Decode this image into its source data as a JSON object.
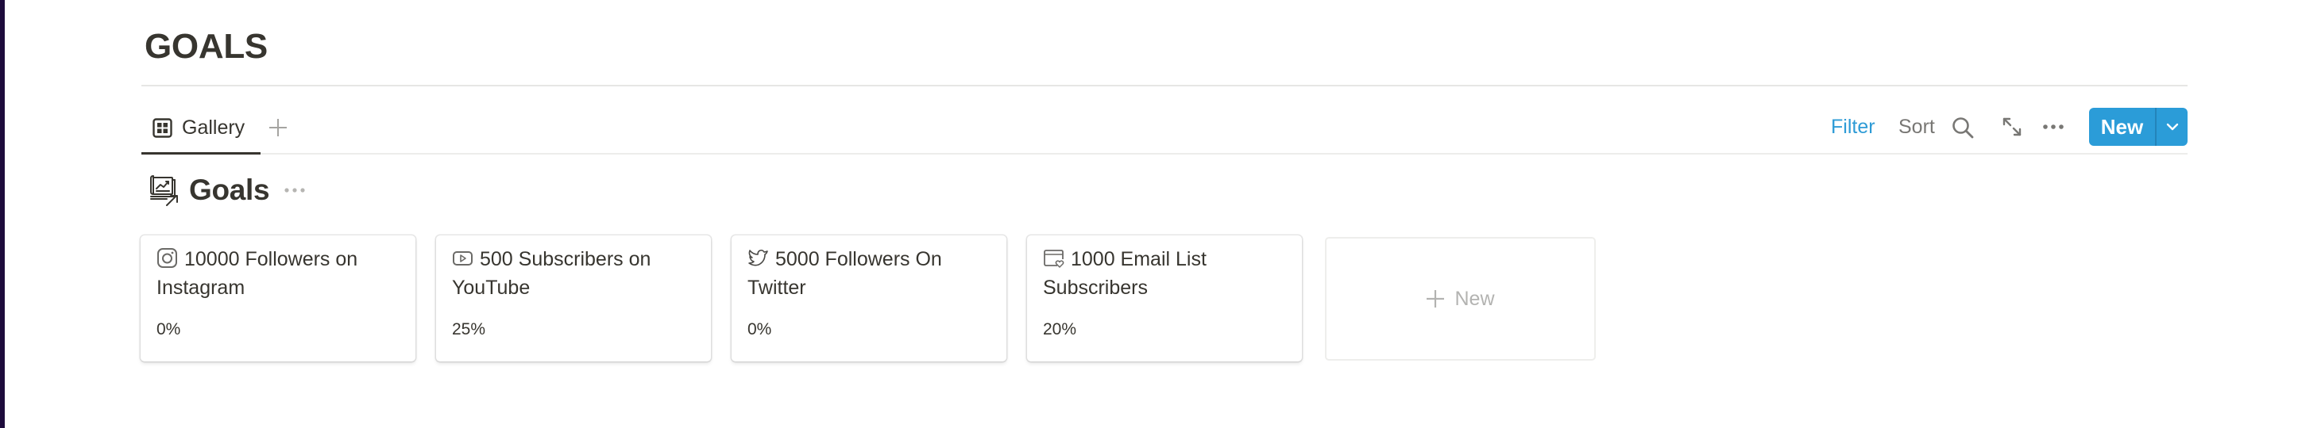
{
  "page": {
    "title": "GOALS"
  },
  "views": {
    "tabs": [
      {
        "label": "Gallery",
        "icon": "gallery-grid-icon",
        "active": true
      }
    ],
    "add_view_icon": "plus-icon"
  },
  "toolbar": {
    "filter_label": "Filter",
    "sort_label": "Sort",
    "search_icon": "search-icon",
    "expand_icon": "expand-icon",
    "more_icon": "more-horizontal-icon",
    "new_label": "New",
    "new_dropdown_icon": "chevron-down-icon"
  },
  "database": {
    "title": "Goals",
    "icon": "chart-documents-icon",
    "more_icon": "more-horizontal-icon"
  },
  "cards": [
    {
      "icon": "instagram-icon",
      "title": "10000 Followers on Instagram",
      "progress": "0%"
    },
    {
      "icon": "youtube-icon",
      "title": "500 Subscribers on YouTube",
      "progress": "25%"
    },
    {
      "icon": "twitter-icon",
      "title": "5000 Followers On Twitter",
      "progress": "0%"
    },
    {
      "icon": "email-list-icon",
      "title": "1000 Email List Subscribers",
      "progress": "20%"
    }
  ],
  "new_card": {
    "label": "New"
  },
  "colors": {
    "accent": "#2b9cd8",
    "filter_active": "#2e9bd6",
    "text": "#37352f",
    "muted": "#787774",
    "sidebar_edge": "#1e0c3c"
  }
}
